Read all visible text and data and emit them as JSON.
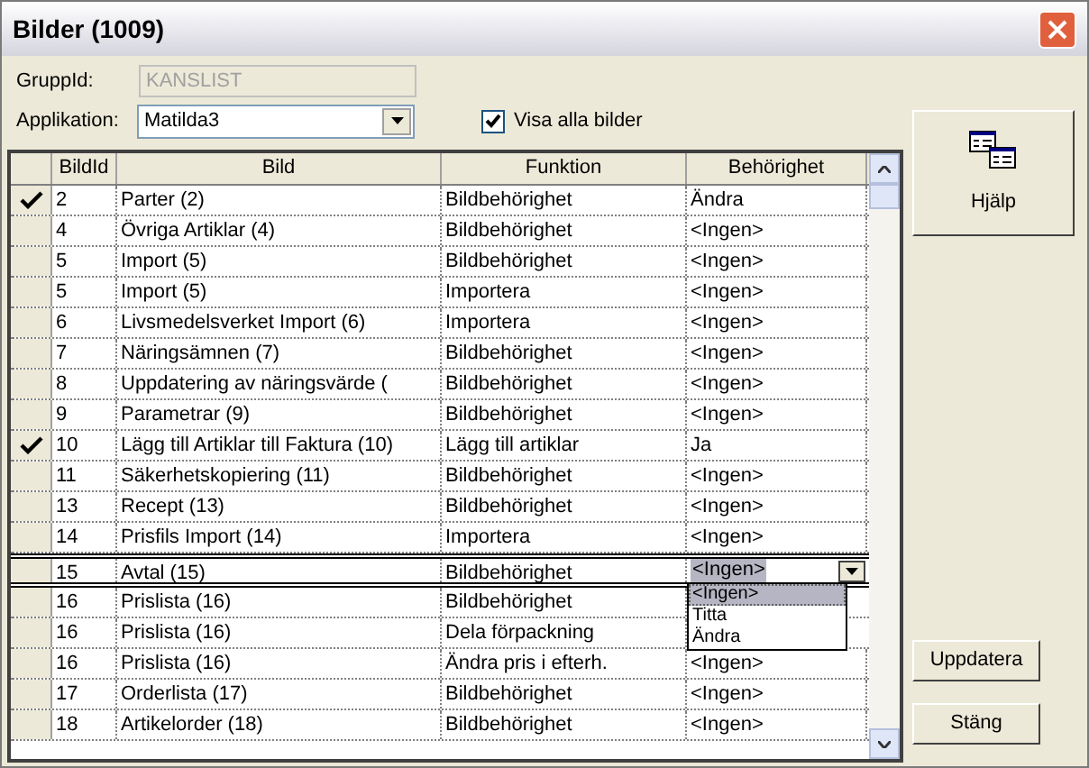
{
  "window": {
    "title": "Bilder (1009)"
  },
  "form": {
    "group_id": {
      "label": "GruppId:",
      "value": "KANSLIST",
      "disabled": true
    },
    "application": {
      "label": "Applikation:",
      "value": "Matilda3"
    },
    "show_all": {
      "label": "Visa alla bilder",
      "checked": true
    }
  },
  "table": {
    "columns": [
      "BildId",
      "Bild",
      "Funktion",
      "Behörighet"
    ],
    "rows": [
      {
        "cells": [
          "2",
          "Parter (2)",
          "Bildbehörighet",
          "Ändra"
        ],
        "checked": true,
        "selected": false
      },
      {
        "cells": [
          "4",
          "Övriga Artiklar (4)",
          "Bildbehörighet",
          "<Ingen>"
        ],
        "checked": false,
        "selected": false
      },
      {
        "cells": [
          "5",
          "Import (5)",
          "Bildbehörighet",
          "<Ingen>"
        ],
        "checked": false,
        "selected": false
      },
      {
        "cells": [
          "5",
          "Import (5)",
          "Importera",
          "<Ingen>"
        ],
        "checked": false,
        "selected": false
      },
      {
        "cells": [
          "6",
          "Livsmedelsverket Import (6)",
          "Importera",
          "<Ingen>"
        ],
        "checked": false,
        "selected": false
      },
      {
        "cells": [
          "7",
          "Näringsämnen (7)",
          "Bildbehörighet",
          "<Ingen>"
        ],
        "checked": false,
        "selected": false
      },
      {
        "cells": [
          "8",
          "Uppdatering av näringsvärde (",
          "Bildbehörighet",
          "<Ingen>"
        ],
        "checked": false,
        "selected": false
      },
      {
        "cells": [
          "9",
          "Parametrar (9)",
          "Bildbehörighet",
          "<Ingen>"
        ],
        "checked": false,
        "selected": false
      },
      {
        "cells": [
          "10",
          "Lägg till Artiklar till Faktura (10)",
          "Lägg till artiklar",
          "Ja"
        ],
        "checked": true,
        "selected": false
      },
      {
        "cells": [
          "11",
          "Säkerhetskopiering (11)",
          "Bildbehörighet",
          "<Ingen>"
        ],
        "checked": false,
        "selected": false
      },
      {
        "cells": [
          "13",
          "Recept (13)",
          "Bildbehörighet",
          "<Ingen>"
        ],
        "checked": false,
        "selected": false
      },
      {
        "cells": [
          "14",
          "Prisfils Import (14)",
          "Importera",
          "<Ingen>"
        ],
        "checked": false,
        "selected": false
      },
      {
        "cells": [
          "15",
          "Avtal (15)",
          "Bildbehörighet",
          "<Ingen>"
        ],
        "checked": false,
        "selected": true
      },
      {
        "cells": [
          "16",
          "Prislista (16)",
          "Bildbehörighet"
        ],
        "checked": false,
        "selected": false
      },
      {
        "cells": [
          "16",
          "Prislista (16)",
          "Dela förpackning"
        ],
        "checked": false,
        "selected": false
      },
      {
        "cells": [
          "16",
          "Prislista (16)",
          "Ändra pris i efterh.",
          "<Ingen>"
        ],
        "checked": false,
        "selected": false
      },
      {
        "cells": [
          "17",
          "Orderlista (17)",
          "Bildbehörighet",
          "<Ingen>"
        ],
        "checked": false,
        "selected": false
      },
      {
        "cells": [
          "18",
          "Artikelorder (18)",
          "Bildbehörighet",
          "<Ingen>"
        ],
        "checked": false,
        "selected": false
      }
    ],
    "editor_options": [
      {
        "label": "<Ingen>",
        "selected": true
      },
      {
        "label": "Titta",
        "selected": false
      },
      {
        "label": "Ändra",
        "selected": false
      }
    ]
  },
  "buttons": {
    "help": "Hjälp",
    "update": "Uppdatera",
    "close": "Stäng"
  }
}
